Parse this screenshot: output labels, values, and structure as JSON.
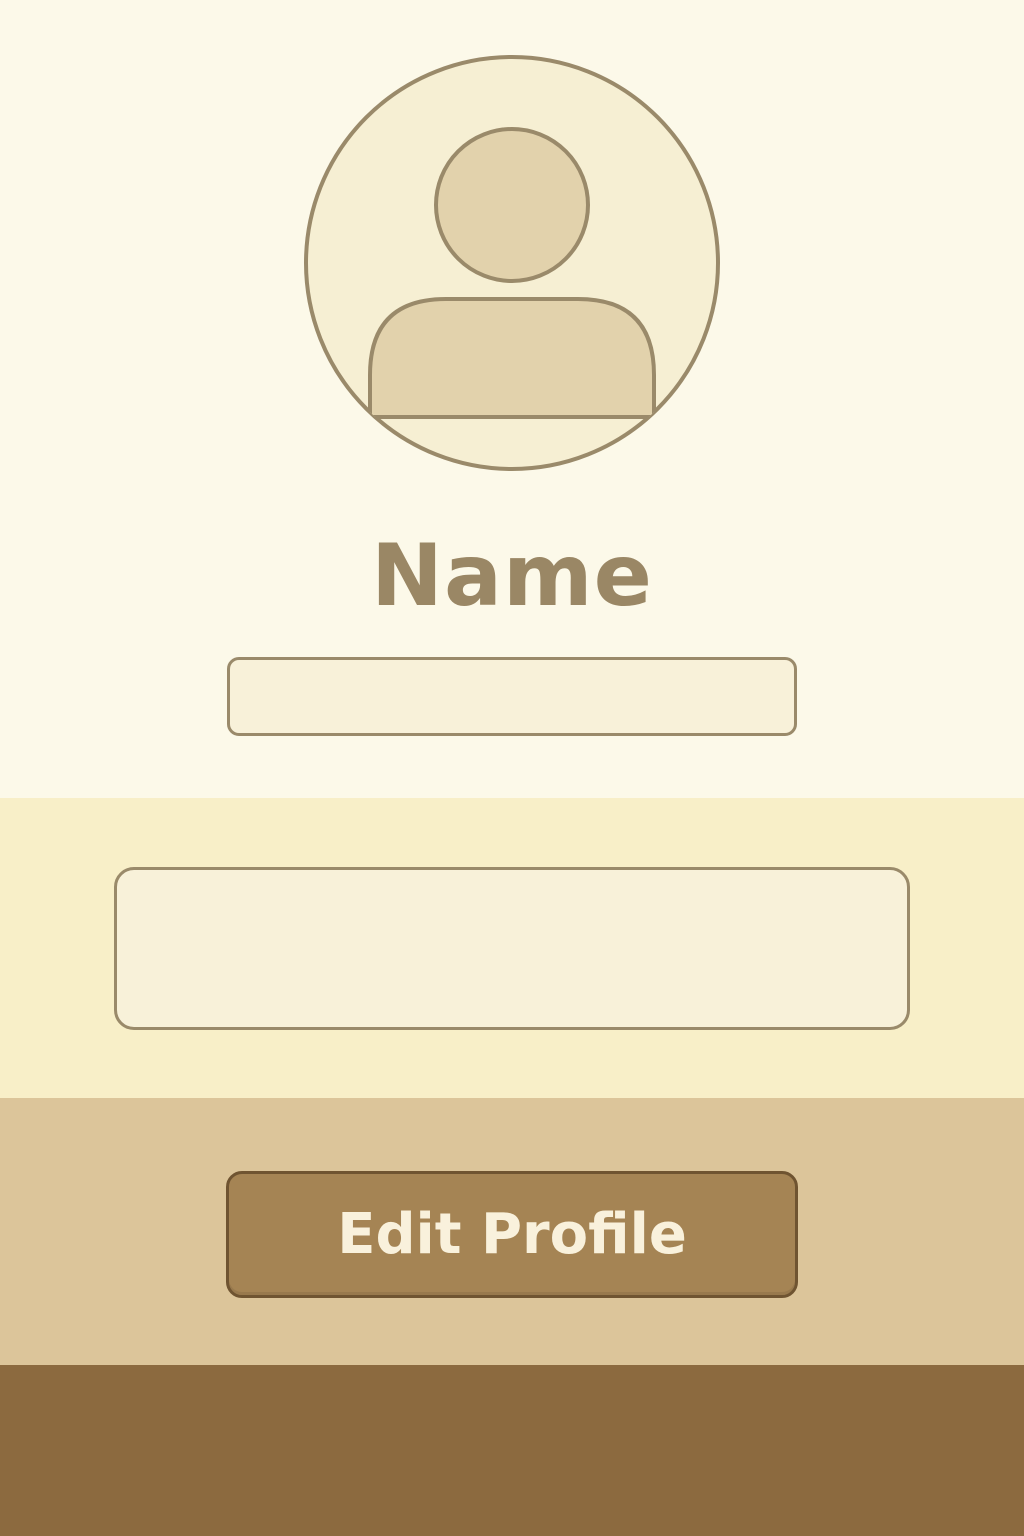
{
  "profile": {
    "avatar_icon": "user-avatar-icon",
    "name_heading": "Name",
    "name_field_value": "",
    "bio_field_value": ""
  },
  "actions": {
    "edit_label": "Edit Profile"
  },
  "colors": {
    "background_top": "#fcf9e9",
    "background_mid": "#f8efc8",
    "background_button_band": "#dcc59a",
    "background_bottom": "#8c6a3f",
    "accent": "#a58454",
    "outline": "#9a8a6a"
  }
}
